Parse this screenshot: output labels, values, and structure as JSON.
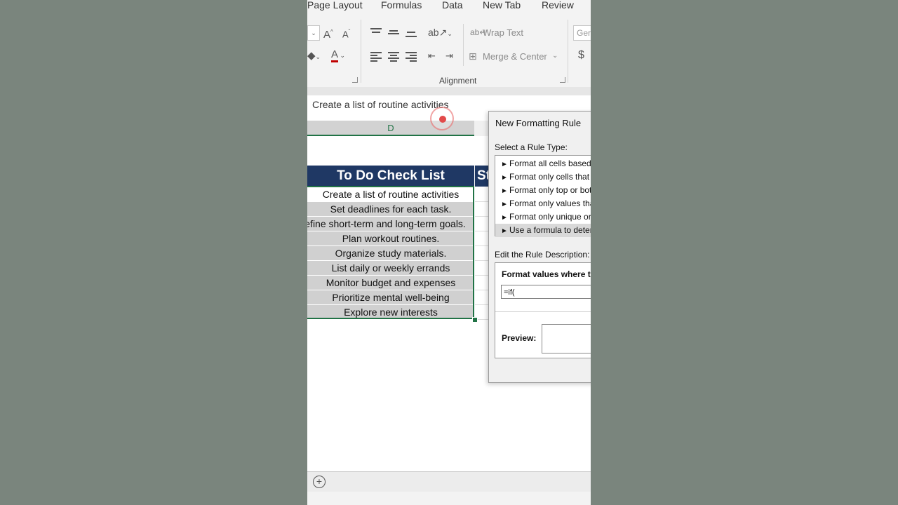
{
  "ribbon": {
    "tabs": [
      "Page Layout",
      "Formulas",
      "Data",
      "New Tab",
      "Review"
    ],
    "wrap_text": "Wrap Text",
    "merge_center": "Merge & Center",
    "group_label": "Alignment",
    "number_format_partial": "Ger",
    "currency_symbol": "$"
  },
  "formula_bar": {
    "value": "Create a list of routine activities"
  },
  "sheet": {
    "column_header": "D",
    "title": "To Do Check List",
    "status_header_partial": "St",
    "tasks": [
      "Create a list of routine activities",
      "Set deadlines for each task.",
      "Define short-term and long-term goals.",
      "Plan workout routines.",
      "Organize study materials.",
      "List daily or weekly errands",
      "Monitor budget and expenses",
      "Prioritize mental well-being",
      "Explore new interests"
    ]
  },
  "dialog": {
    "title": "New Formatting Rule",
    "select_rule_label": "Select a Rule Type:",
    "rule_types": [
      "Format all cells based on their values",
      "Format only cells that contain",
      "Format only top or bottom ranked values",
      "Format only values that are above or below average",
      "Format only unique or duplicate values",
      "Use a formula to determine which cells to format"
    ],
    "edit_rule_label": "Edit the Rule Description:",
    "format_values_label": "Format values where this formula is true:",
    "formula_value": "=if(",
    "preview_label": "Preview:"
  },
  "colors": {
    "header_fill": "#1f3864",
    "excel_green": "#217346",
    "row_fill": "#d0d0d0"
  }
}
